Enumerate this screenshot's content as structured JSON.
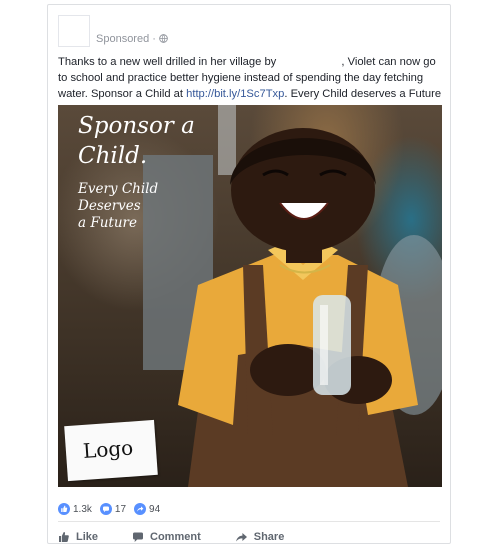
{
  "post": {
    "sponsored_label": "Sponsored",
    "separator": "·",
    "text_part1": "Thanks to a new well drilled in her village by",
    "text_part2": ", Violet can now go to school and practice better hygiene instead of spending the day fetching water. Sponsor a Child at",
    "link": "http://bit.ly/1Sc7Txp",
    "text_part3": ". Every Child deserves a Future"
  },
  "image": {
    "headline_line1": "Sponsor a",
    "headline_line2": "Child.",
    "tagline_line1": "Every Child",
    "tagline_line2": "Deserves",
    "tagline_line3": "a Future",
    "logo_text": "Logo"
  },
  "reactions": {
    "likes": "1.3k",
    "comments": "17",
    "shares": "94"
  },
  "actions": {
    "like": "Like",
    "comment": "Comment",
    "share": "Share"
  },
  "colors": {
    "link": "#365899",
    "reaction_blue": "#5890ff"
  }
}
